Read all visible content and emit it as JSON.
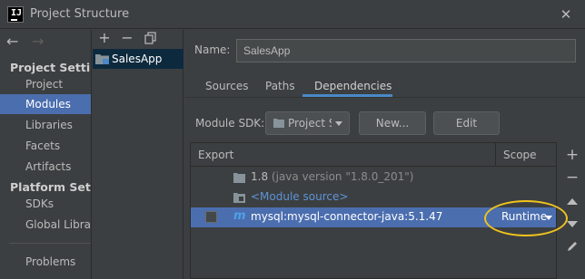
{
  "window": {
    "title": "Project Structure",
    "close_icon": "close-icon",
    "app_icon": "intellij-icon"
  },
  "nav": {
    "back_icon": "back-arrow-icon",
    "forward_icon": "forward-arrow-icon",
    "sections": [
      {
        "title": "Project Settings",
        "items": [
          "Project",
          "Modules",
          "Libraries",
          "Facets",
          "Artifacts"
        ]
      },
      {
        "title": "Platform Settings",
        "items": [
          "SDKs",
          "Global Libraries"
        ]
      }
    ],
    "extra_items": [
      "Problems"
    ],
    "selected": "Modules"
  },
  "modules": {
    "toolbar": [
      "add-icon",
      "remove-icon",
      "copy-icon"
    ],
    "items": [
      {
        "label": "SalesApp",
        "selected": true
      }
    ]
  },
  "details": {
    "name_label": "Name:",
    "name_value": "SalesApp",
    "tabs": [
      "Sources",
      "Paths",
      "Dependencies"
    ],
    "active_tab": "Dependencies",
    "sdk_label": "Module SDK:",
    "sdk_value": "Project SDK",
    "new_button": "New...",
    "edit_button": "Edit"
  },
  "dependencies": {
    "columns": {
      "export": "Export",
      "scope": "Scope"
    },
    "rows": [
      {
        "name": "1.8",
        "detail": "(java version \"1.8.0_201\")",
        "icon": "jdk-folder-icon"
      },
      {
        "name": "<Module source>",
        "icon": "module-source-folder-icon"
      },
      {
        "name": "mysql:mysql-connector-java:5.1.47",
        "icon": "maven-icon",
        "scope": "Runtime",
        "selected": true
      }
    ],
    "side_toolbar": [
      "add-icon",
      "remove-icon",
      "move-up-icon",
      "move-down-icon",
      "edit-icon"
    ],
    "highlight_color": "#f0c31e",
    "selection_color": "#4b6eaf"
  }
}
